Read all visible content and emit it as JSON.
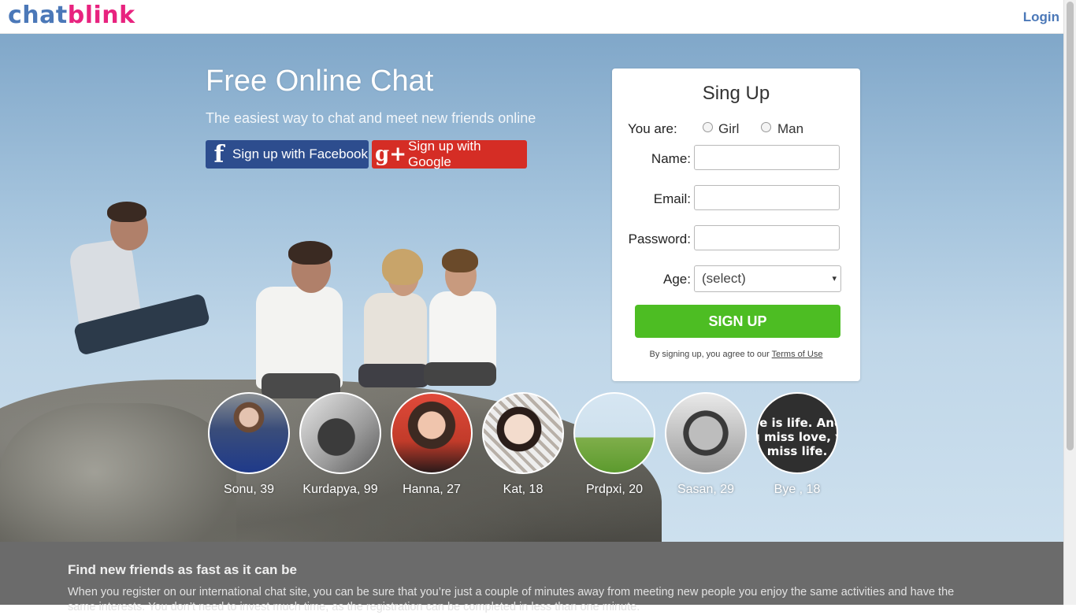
{
  "header": {
    "logo_part1": "chat",
    "logo_part2": "blink",
    "login_label": "Login"
  },
  "hero": {
    "title": "Free Online Chat",
    "subtitle": "The easiest way to chat and meet new friends online",
    "facebook_button": "Sign up with Facebook",
    "facebook_icon": "f",
    "google_button": "Sign up with Google",
    "google_icon": "g+"
  },
  "signup": {
    "title": "Sing Up",
    "you_are_label": "You are:",
    "gender_options": [
      "Girl",
      "Man"
    ],
    "name_label": "Name:",
    "name_value": "",
    "email_label": "Email:",
    "email_value": "",
    "password_label": "Password:",
    "password_value": "",
    "age_label": "Age:",
    "age_selected": "(select)",
    "submit_label": "SIGN UP",
    "terms_text": "By signing up, you agree to our",
    "terms_link": "Terms of Use"
  },
  "profiles": [
    {
      "name": "Sonu, 39"
    },
    {
      "name": "Kurdapya, 99"
    },
    {
      "name": "Hanna, 27"
    },
    {
      "name": "Kat, 18"
    },
    {
      "name": "Prdpxi, 20"
    },
    {
      "name": "Sasan, 29"
    },
    {
      "name": "Bye , 18",
      "quote": "ve is life. And\nu miss love, y\nmiss life."
    }
  ],
  "info": {
    "title": "Find new friends as fast as it can be",
    "text": "When you register on our international chat site, you can be sure that you’re just a couple of minutes away from meeting new people you enjoy the same activities and have the same interests. You don’t need to invest much time, as the registration can be completed in less than one minute."
  },
  "colors": {
    "brand_blue": "#4b78b8",
    "brand_pink": "#e8237f",
    "facebook": "#2d4d8e",
    "google": "#d52d25",
    "signup_green": "#4dbd23",
    "info_band": "#6b6b6b"
  }
}
